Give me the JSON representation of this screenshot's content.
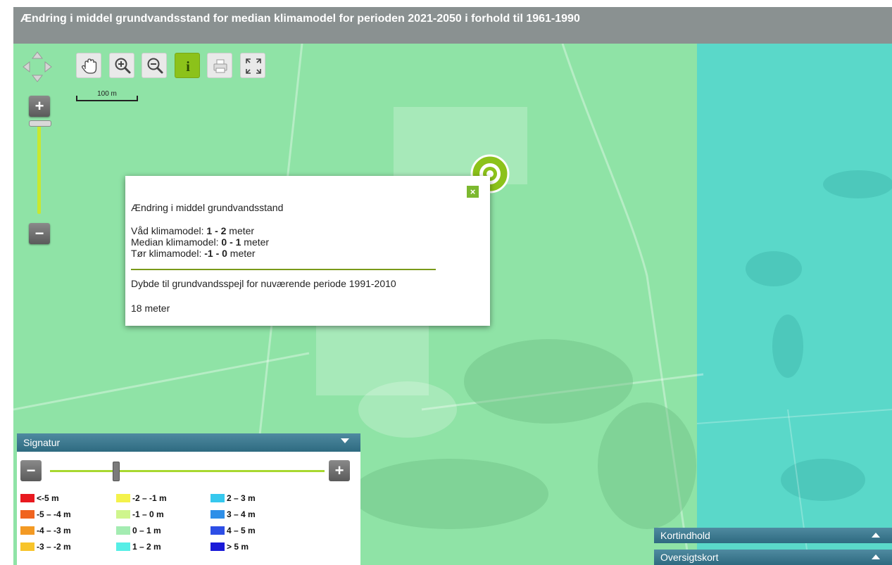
{
  "title": "Ændring i middel grundvandsstand for median klimamodel for perioden 2021-2050 i forhold til 1961-1990",
  "map": {
    "colors": {
      "green_zone": "#8fe3a6",
      "cyan_zone": "#5ad8c9"
    },
    "zoom_in_label": "+",
    "zoom_out_label": "−",
    "scale_label": "100 m"
  },
  "toolbar": {
    "tools": [
      {
        "id": "pan",
        "icon": "hand-icon"
      },
      {
        "id": "zoom-in",
        "icon": "zoom-in-icon"
      },
      {
        "id": "zoom-out",
        "icon": "zoom-out-icon"
      },
      {
        "id": "info",
        "icon": "info-icon",
        "active": true,
        "label": "i"
      },
      {
        "id": "print",
        "icon": "print-icon"
      },
      {
        "id": "fullscreen",
        "icon": "fullscreen-icon"
      }
    ]
  },
  "popup": {
    "close_label": "×",
    "title": "Ændring i middel grundvandsstand",
    "rows": [
      {
        "label": "Våd klimamodel: ",
        "value": "1 - 2",
        "unit": " meter"
      },
      {
        "label": "Median klimamodel: ",
        "value": "0 - 1",
        "unit": " meter"
      },
      {
        "label": "Tør klimamodel: ",
        "value": "-1 - 0",
        "unit": " meter"
      }
    ],
    "depth_title": "Dybde til grundvandsspejl for nuværende periode 1991-2010",
    "depth_value": "18 meter"
  },
  "legend": {
    "title": "Signatur",
    "minus_label": "−",
    "plus_label": "+",
    "opacity_value": 0.24,
    "items": [
      {
        "label": "<-5 m",
        "color": "#e8191f"
      },
      {
        "label": "-5 – -4 m",
        "color": "#f0641f"
      },
      {
        "label": "-4 – -3 m",
        "color": "#f39a24"
      },
      {
        "label": "-3 – -2 m",
        "color": "#f7c42b"
      },
      {
        "label": "-2 – -1 m",
        "color": "#f4f24b"
      },
      {
        "label": "-1 – 0 m",
        "color": "#cff58d"
      },
      {
        "label": "0 – 1 m",
        "color": "#a4ecb2"
      },
      {
        "label": "1 – 2 m",
        "color": "#56eee6"
      },
      {
        "label": "2 – 3 m",
        "color": "#36c8ee"
      },
      {
        "label": "3 – 4 m",
        "color": "#2e8fe8"
      },
      {
        "label": "4 – 5 m",
        "color": "#2d4ee6"
      },
      {
        "label": "> 5 m",
        "color": "#1a1ad8"
      }
    ]
  },
  "panels": {
    "kortindhold": "Kortindhold",
    "oversigtskort": "Oversigtskort"
  }
}
